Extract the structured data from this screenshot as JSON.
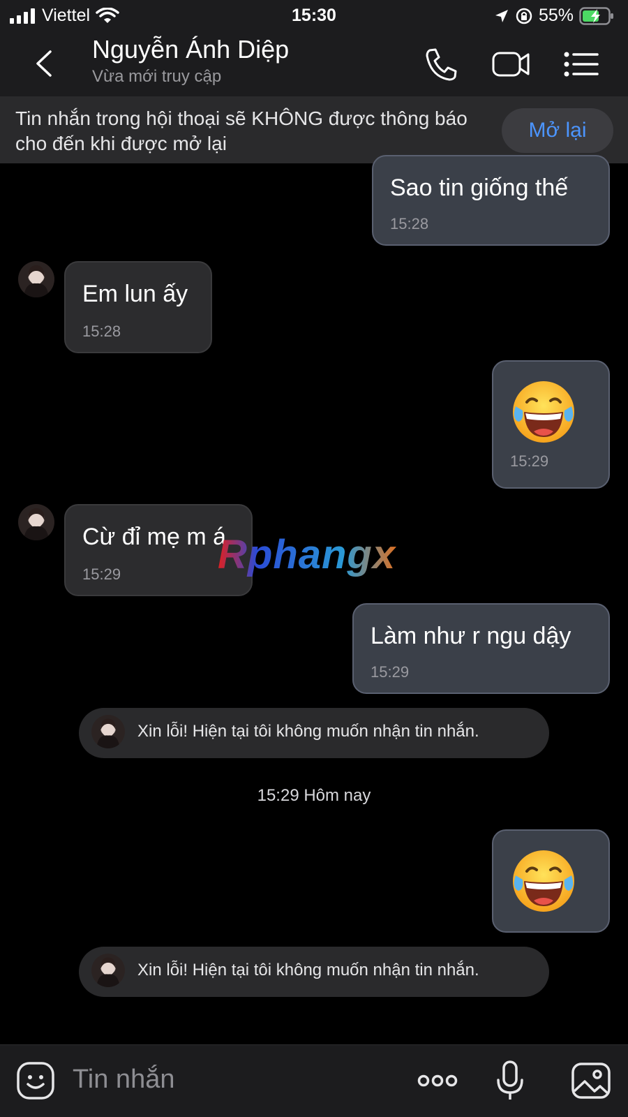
{
  "status_bar": {
    "carrier": "Viettel",
    "time": "15:30",
    "battery": "55%"
  },
  "header": {
    "contact_name": "Nguyễn Ánh Diệp",
    "contact_status": "Vừa mới truy cập",
    "icons": [
      "back-icon",
      "phone-icon",
      "video-icon",
      "menu-icon"
    ]
  },
  "mute_banner": {
    "text": "Tin nhắn trong hội thoại sẽ KHÔNG được thông báo cho đến khi được mở lại",
    "button_label": "Mở lại"
  },
  "messages": [
    {
      "side": "sent",
      "text": "Sao tin giống thế",
      "time": "15:28"
    },
    {
      "side": "recv",
      "text": "Em lun ấy",
      "time": "15:28"
    },
    {
      "side": "sent",
      "emoji": "😂",
      "time": "15:29"
    },
    {
      "side": "recv",
      "text": "Cừ đỉ mẹ m á",
      "time": "15:29"
    },
    {
      "side": "sent",
      "text": "Làm như r ngu dậy",
      "time": "15:29"
    },
    {
      "type": "system",
      "text": "Xin lỗi! Hiện tại tôi không muốn nhận tin nhắn."
    },
    {
      "type": "date",
      "text": "15:29 Hôm nay"
    },
    {
      "side": "sent",
      "emoji": "😂"
    },
    {
      "type": "system",
      "text": "Xin lỗi! Hiện tại tôi không muốn nhận tin nhắn."
    }
  ],
  "watermark": "Rphangx",
  "input_bar": {
    "placeholder": "Tin nhắn",
    "icons": [
      "sticker-icon",
      "more-icon",
      "mic-icon",
      "image-icon"
    ]
  },
  "colors": {
    "background": "#000000",
    "bar": "#1c1c1e",
    "sent_bubble": "#3b4049",
    "recv_bubble": "#2c2c2e",
    "accent": "#4c95ff",
    "battery": "#4cd964"
  }
}
